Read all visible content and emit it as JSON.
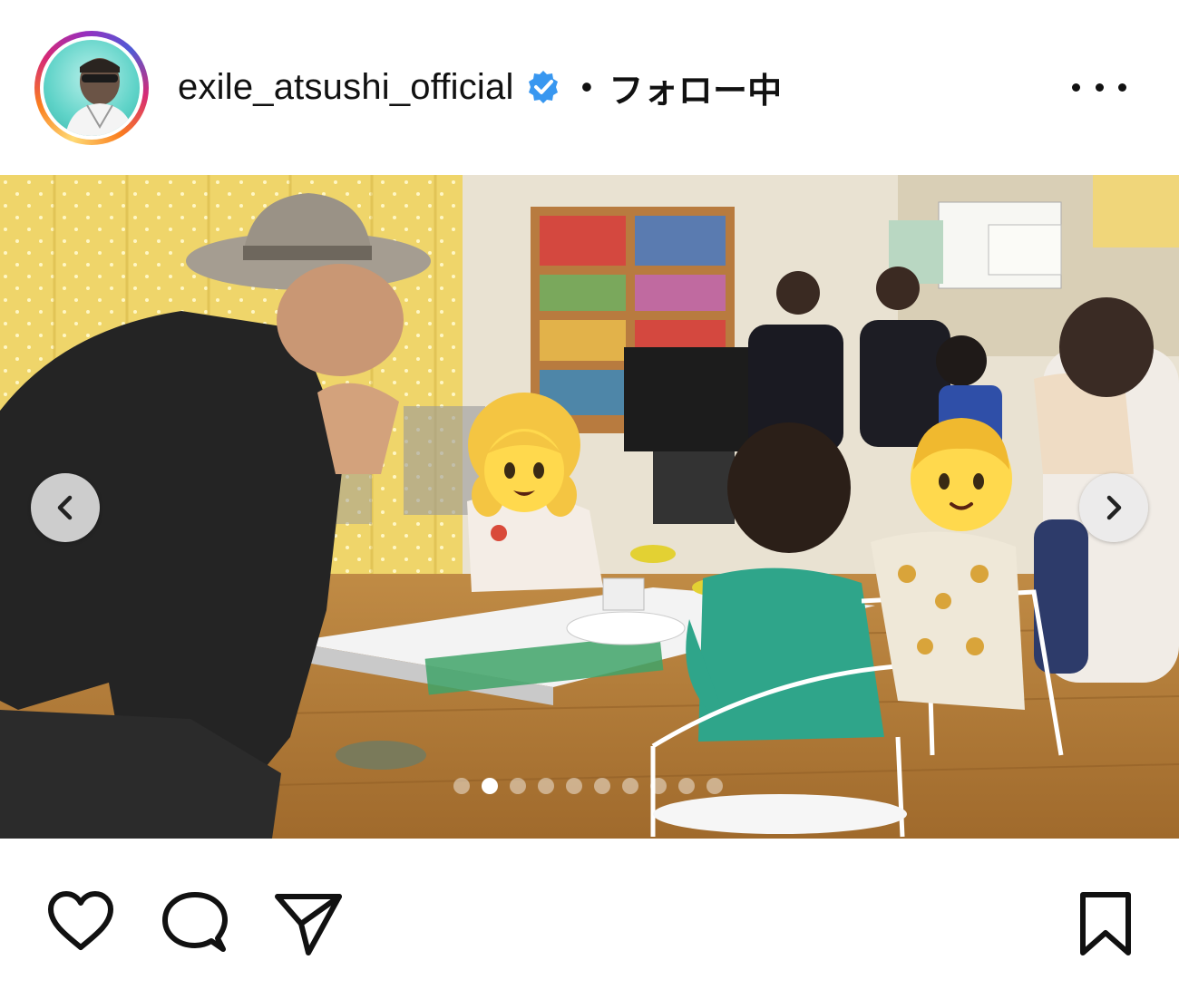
{
  "header": {
    "username": "exile_atsushi_official",
    "separator": "•",
    "follow_status": "フォロー中"
  },
  "icons": {
    "verified": "verified-badge-icon",
    "more": "more-options-icon",
    "prev": "chevron-left-icon",
    "next": "chevron-right-icon",
    "like": "heart-icon",
    "comment": "comment-icon",
    "share": "paper-plane-icon",
    "save": "bookmark-icon"
  },
  "carousel": {
    "total_slides": 10,
    "active_index": 1
  },
  "colors": {
    "verified_blue": "#3897f0",
    "text": "#111111",
    "story_ring": [
      "#feda75",
      "#fa7e1e",
      "#d62976",
      "#962fbf",
      "#4f5bd5"
    ]
  }
}
